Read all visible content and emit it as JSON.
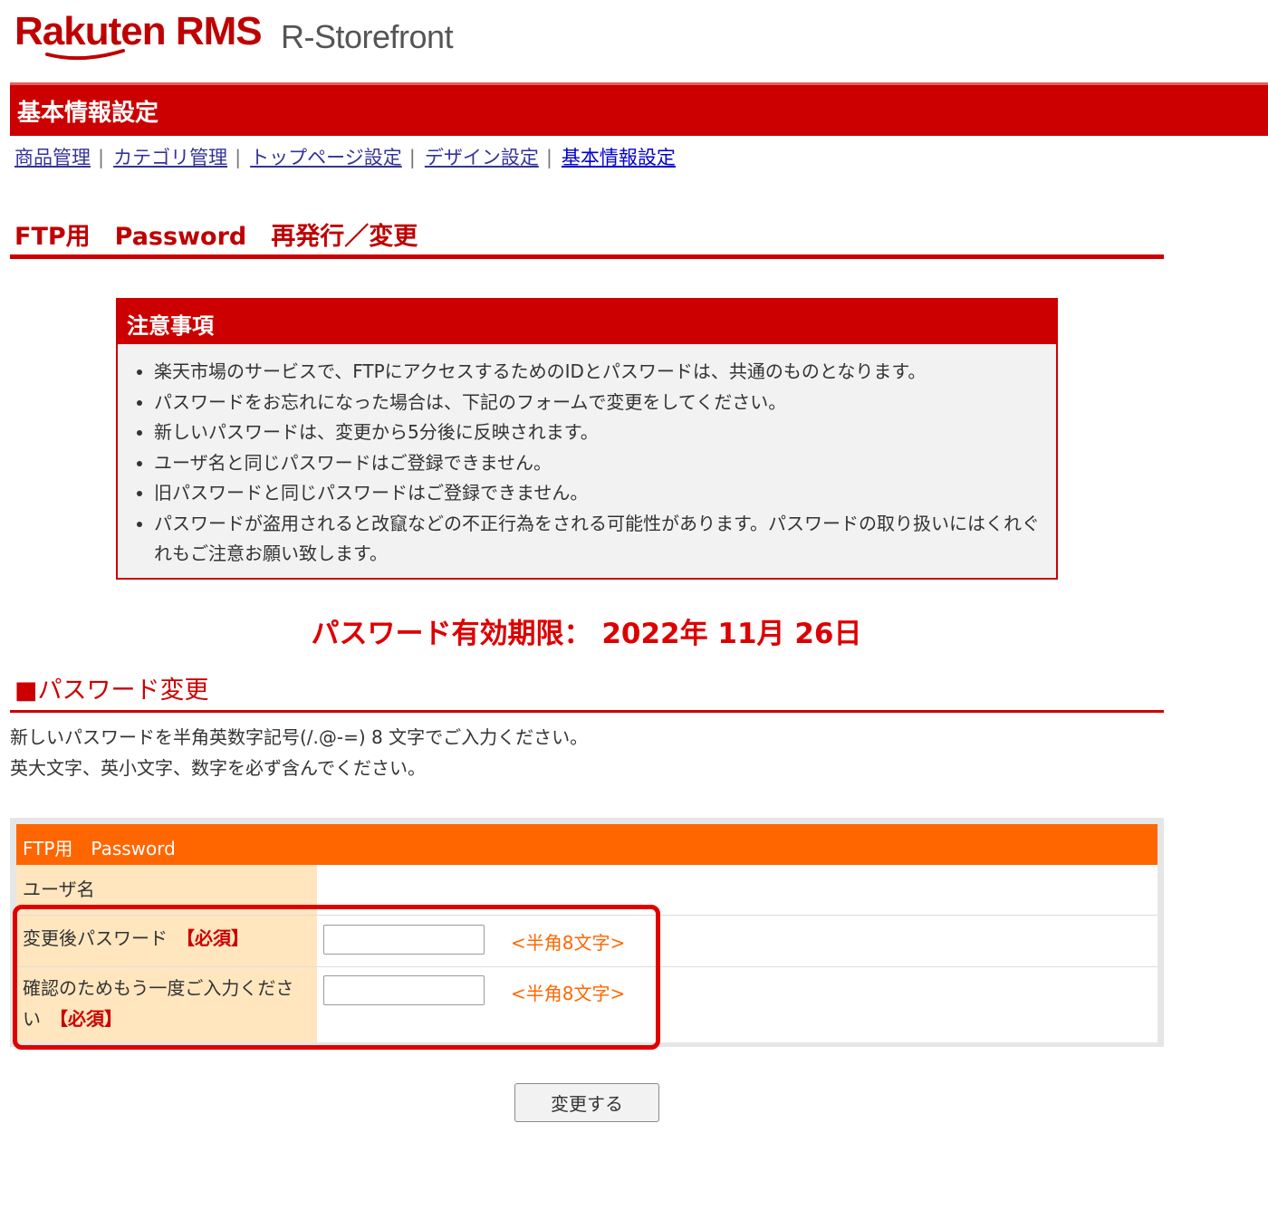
{
  "header": {
    "brand": "Rakuten RMS",
    "product": "R-Storefront"
  },
  "section_bar": {
    "title": "基本情報設定"
  },
  "nav": {
    "items": [
      "商品管理",
      "カテゴリ管理",
      "トップページ設定",
      "デザイン設定",
      "基本情報設定"
    ],
    "separator": "|"
  },
  "page": {
    "title": "FTP用　Password　再発行／変更"
  },
  "notice": {
    "title": "注意事項",
    "items": [
      "楽天市場のサービスで、FTPにアクセスするためのIDとパスワードは、共通のものとなります。",
      "パスワードをお忘れになった場合は、下記のフォームで変更をしてください。",
      "新しいパスワードは、変更から5分後に反映されます。",
      "ユーザ名と同じパスワードはご登録できません。",
      "旧パスワードと同じパスワードはご登録できません。",
      "パスワードが盗用されると改竄などの不正行為をされる可能性があります。パスワードの取り扱いにはくれぐれもご注意お願い致します。"
    ]
  },
  "expiry": {
    "text": "パスワード有効期限： 2022年 11月 26日"
  },
  "change_section": {
    "title": "■パスワード変更",
    "instructions": [
      "新しいパスワードを半角英数字記号(/.@-=) 8 文字でご入力ください。",
      "英大文字、英小文字、数字を必ず含んでください。"
    ]
  },
  "form": {
    "header": "FTP用　Password",
    "username_label": "ユーザ名",
    "username_value": "",
    "new_password_label": "変更後パスワード",
    "confirm_password_label": "確認のためもう一度ご入力ください",
    "required_tag": "【必須】",
    "hint": "<半角8文字>",
    "new_password_value": "",
    "confirm_password_value": ""
  },
  "submit_label": "変更する",
  "colors": {
    "brand_red": "#bf0000",
    "accent_orange": "#ff6600",
    "label_bg": "#ffe6bf",
    "highlight": "#e00000"
  }
}
